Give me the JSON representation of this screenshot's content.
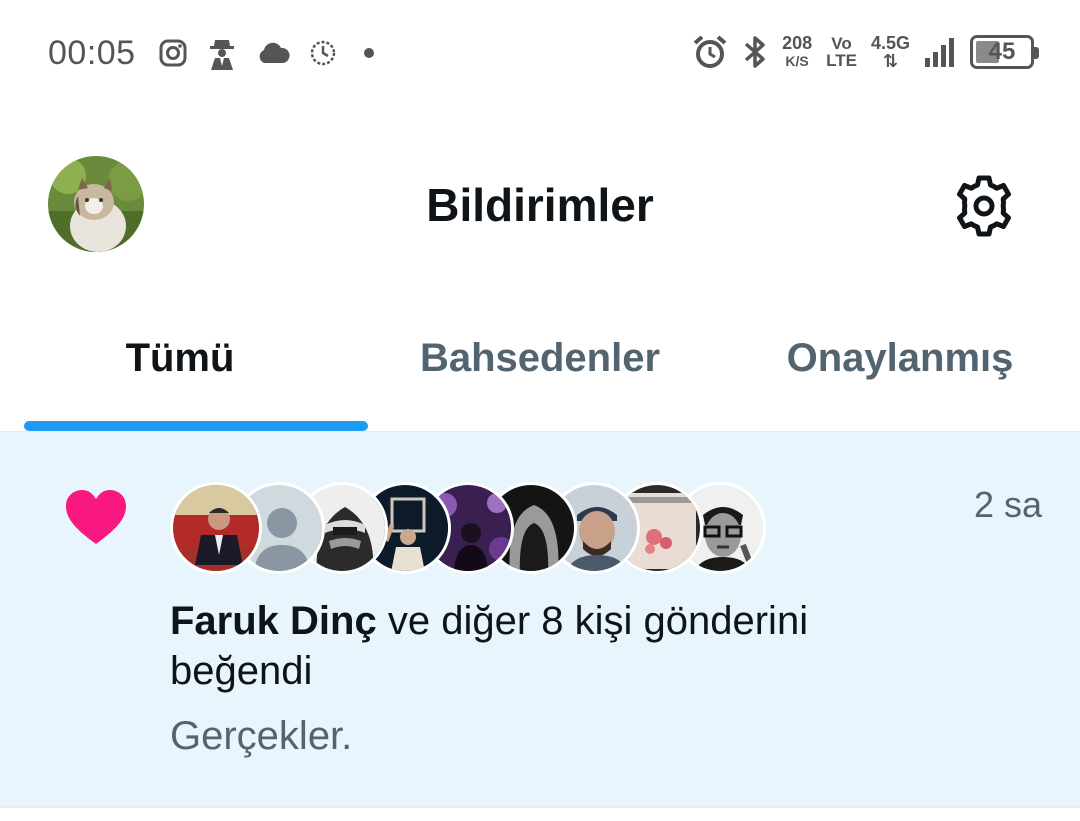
{
  "status_bar": {
    "time": "00:05",
    "icons_left": [
      "instagram-icon",
      "spy-icon",
      "cloud-icon",
      "timer-icon",
      "dot-icon"
    ],
    "speed_value": "208",
    "speed_unit": "K/S",
    "volte_top": "Vo",
    "volte_bottom": "LTE",
    "network_type": "4.5G",
    "network_arrows": "⇅",
    "battery": "45",
    "battery_level": 0.45
  },
  "header": {
    "title": "Bildirimler"
  },
  "tabs": [
    {
      "label": "Tümü",
      "active": true
    },
    {
      "label": "Bahsedenler",
      "active": false
    },
    {
      "label": "Onaylanmış",
      "active": false
    }
  ],
  "notification": {
    "time": "2 sa",
    "actor": "Faruk Dinç",
    "action_text": "ve diğer 8 kişi gönderini beğendi",
    "preview": "Gerçekler.",
    "avatar_count": 9,
    "accent_color": "#f91880",
    "background": "#e8f5fd"
  },
  "colors": {
    "tab_underline": "#1d9bf0",
    "text_secondary": "#536471",
    "text_primary": "#0f1419"
  }
}
